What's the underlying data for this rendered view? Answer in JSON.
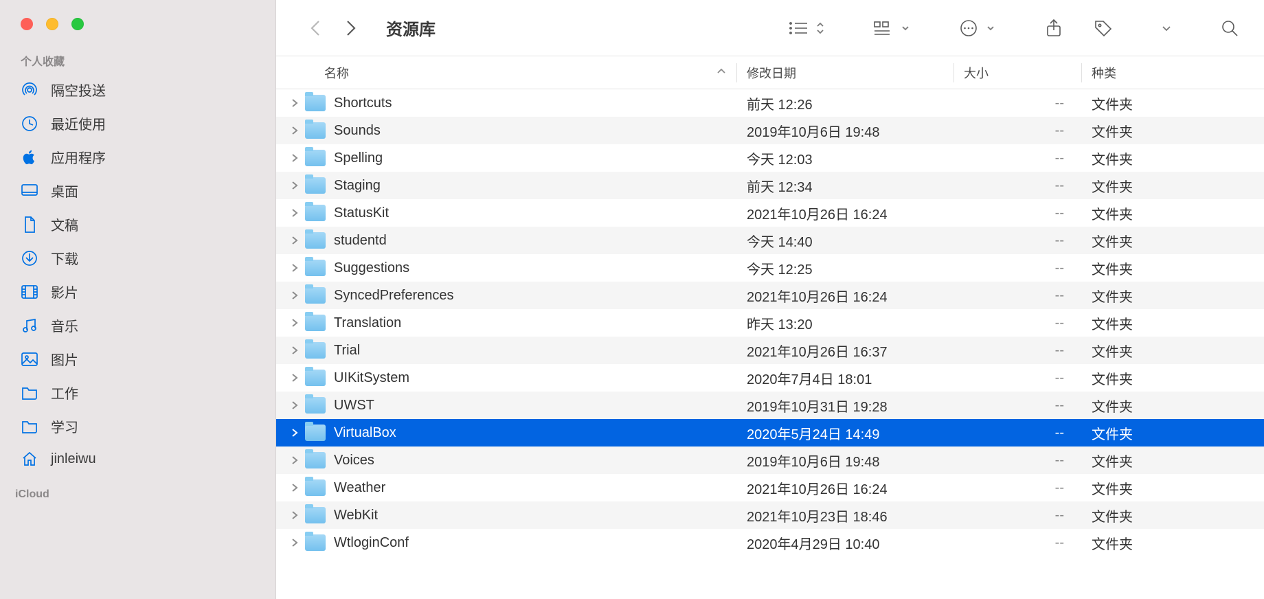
{
  "window": {
    "title": "资源库"
  },
  "sidebar": {
    "favorites_label": "个人收藏",
    "icloud_label": "iCloud",
    "items": [
      {
        "icon": "airdrop",
        "label": "隔空投送"
      },
      {
        "icon": "clock",
        "label": "最近使用"
      },
      {
        "icon": "apps",
        "label": "应用程序"
      },
      {
        "icon": "desktop",
        "label": "桌面"
      },
      {
        "icon": "doc",
        "label": "文稿"
      },
      {
        "icon": "download",
        "label": "下载"
      },
      {
        "icon": "movie",
        "label": "影片"
      },
      {
        "icon": "music",
        "label": "音乐"
      },
      {
        "icon": "picture",
        "label": "图片"
      },
      {
        "icon": "folder",
        "label": "工作"
      },
      {
        "icon": "folder",
        "label": "学习"
      },
      {
        "icon": "home",
        "label": "jinleiwu"
      }
    ]
  },
  "columns": {
    "name": "名称",
    "date": "修改日期",
    "size": "大小",
    "kind": "种类"
  },
  "rows": [
    {
      "name": "Shortcuts",
      "date": "前天 12:26",
      "size": "--",
      "kind": "文件夹",
      "selected": false
    },
    {
      "name": "Sounds",
      "date": "2019年10月6日 19:48",
      "size": "--",
      "kind": "文件夹",
      "selected": false
    },
    {
      "name": "Spelling",
      "date": "今天 12:03",
      "size": "--",
      "kind": "文件夹",
      "selected": false
    },
    {
      "name": "Staging",
      "date": "前天 12:34",
      "size": "--",
      "kind": "文件夹",
      "selected": false
    },
    {
      "name": "StatusKit",
      "date": "2021年10月26日 16:24",
      "size": "--",
      "kind": "文件夹",
      "selected": false
    },
    {
      "name": "studentd",
      "date": "今天 14:40",
      "size": "--",
      "kind": "文件夹",
      "selected": false
    },
    {
      "name": "Suggestions",
      "date": "今天 12:25",
      "size": "--",
      "kind": "文件夹",
      "selected": false
    },
    {
      "name": "SyncedPreferences",
      "date": "2021年10月26日 16:24",
      "size": "--",
      "kind": "文件夹",
      "selected": false
    },
    {
      "name": "Translation",
      "date": "昨天 13:20",
      "size": "--",
      "kind": "文件夹",
      "selected": false
    },
    {
      "name": "Trial",
      "date": "2021年10月26日 16:37",
      "size": "--",
      "kind": "文件夹",
      "selected": false
    },
    {
      "name": "UIKitSystem",
      "date": "2020年7月4日 18:01",
      "size": "--",
      "kind": "文件夹",
      "selected": false
    },
    {
      "name": "UWST",
      "date": "2019年10月31日 19:28",
      "size": "--",
      "kind": "文件夹",
      "selected": false
    },
    {
      "name": "VirtualBox",
      "date": "2020年5月24日 14:49",
      "size": "--",
      "kind": "文件夹",
      "selected": true
    },
    {
      "name": "Voices",
      "date": "2019年10月6日 19:48",
      "size": "--",
      "kind": "文件夹",
      "selected": false
    },
    {
      "name": "Weather",
      "date": "2021年10月26日 16:24",
      "size": "--",
      "kind": "文件夹",
      "selected": false
    },
    {
      "name": "WebKit",
      "date": "2021年10月23日 18:46",
      "size": "--",
      "kind": "文件夹",
      "selected": false
    },
    {
      "name": "WtloginConf",
      "date": "2020年4月29日 10:40",
      "size": "--",
      "kind": "文件夹",
      "selected": false
    }
  ]
}
